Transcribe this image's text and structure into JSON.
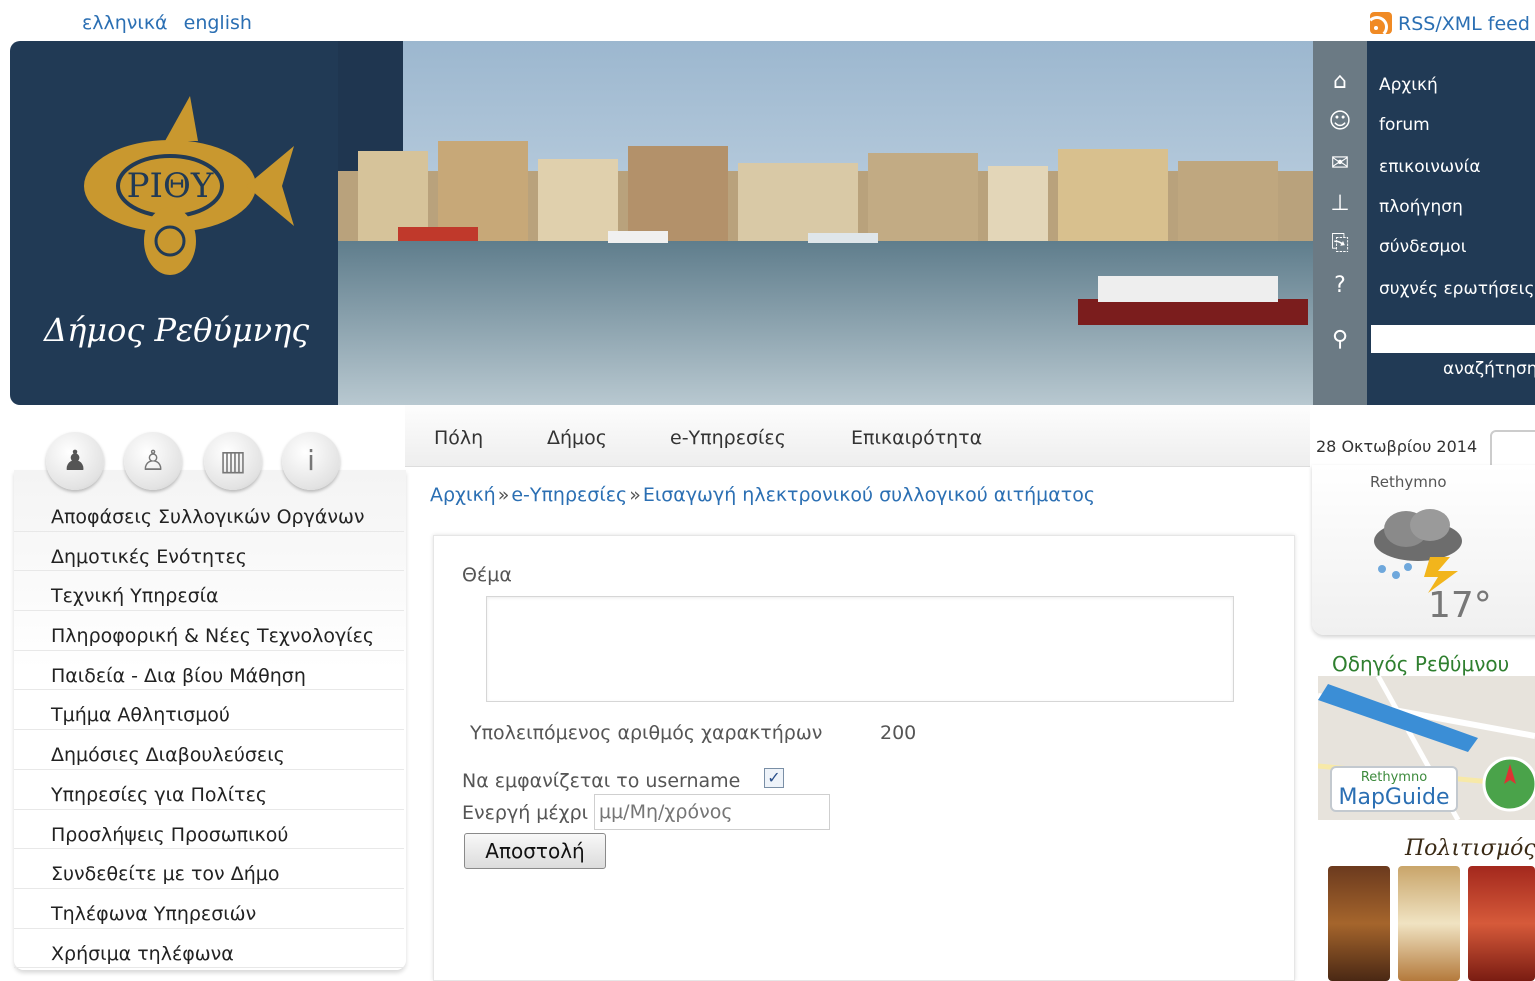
{
  "languages": [
    "ελληνικά",
    "english"
  ],
  "rss_label": "RSS/XML feed",
  "logo": {
    "emblem_text": "ΡΙΘΥ",
    "name": "Δήμος Ρεθύμνης"
  },
  "top_nav": {
    "items": [
      {
        "label": "Αρχική",
        "icon": "home-icon"
      },
      {
        "label": "forum",
        "icon": "people-icon"
      },
      {
        "label": "επικοινωνία",
        "icon": "mail-icon"
      },
      {
        "label": "πλοήγηση",
        "icon": "sitemap-icon"
      },
      {
        "label": "σύνδεσμοι",
        "icon": "links-icon"
      },
      {
        "label": "συχνές ερωτήσεις",
        "icon": "question-icon"
      }
    ],
    "search_label": "αναζήτηση",
    "search_value": ""
  },
  "menu": [
    "Πόλη",
    "Δήμος",
    "e-Υπηρεσίες",
    "Επικαιρότητα"
  ],
  "breadcrumb": [
    "Αρχική",
    "e-Υπηρεσίες",
    "Εισαγωγή ηλεκτρονικού συλλογικού αιτήματος"
  ],
  "sidebar": {
    "round_buttons": [
      "person-icon",
      "visitor-icon",
      "business-icon",
      "info-icon"
    ],
    "items": [
      "Αποφάσεις Συλλογικών Οργάνων",
      "Δημοτικές Ενότητες",
      "Τεχνική Υπηρεσία",
      "Πληροφορική & Νέες Τεχνολογίες",
      "Παιδεία - Δια βίου Μάθηση",
      "Τμήμα Αθλητισμού",
      "Δημόσιες Διαβουλεύσεις",
      "Υπηρεσίες για Πολίτες",
      "Προσλήψεις Προσωπικού",
      "Συνδεθείτε με τον Δήμο",
      "Τηλέφωνα Υπηρεσιών",
      "Χρήσιμα τηλέφωνα"
    ]
  },
  "form": {
    "subject_label": "Θέμα",
    "subject_value": "",
    "remaining_label": "Υπολειπόμενος αριθμός χαρακτήρων",
    "remaining_count": "200",
    "show_username_label": "Να εμφανίζεται το username",
    "show_username_checked": true,
    "active_until_label": "Ενεργή μέχρι",
    "date_placeholder": "μμ/Μη/χρόνος",
    "submit_label": "Αποστολή"
  },
  "right": {
    "date": "28 Οκτωβρίου 2014",
    "weather_city": "Rethymno",
    "weather_temp": "17°",
    "guide_title": "Οδηγός Ρεθύμνου",
    "guide_badge_small": "Rethymno",
    "guide_badge_big": "MapGuide",
    "culture_title": "Πολιτισμός"
  },
  "colors": {
    "header_dark": "#213a55",
    "nav_icon_strip": "#6b7a84",
    "link_blue": "#2b6fb3",
    "logo_gold": "#c9982f"
  }
}
